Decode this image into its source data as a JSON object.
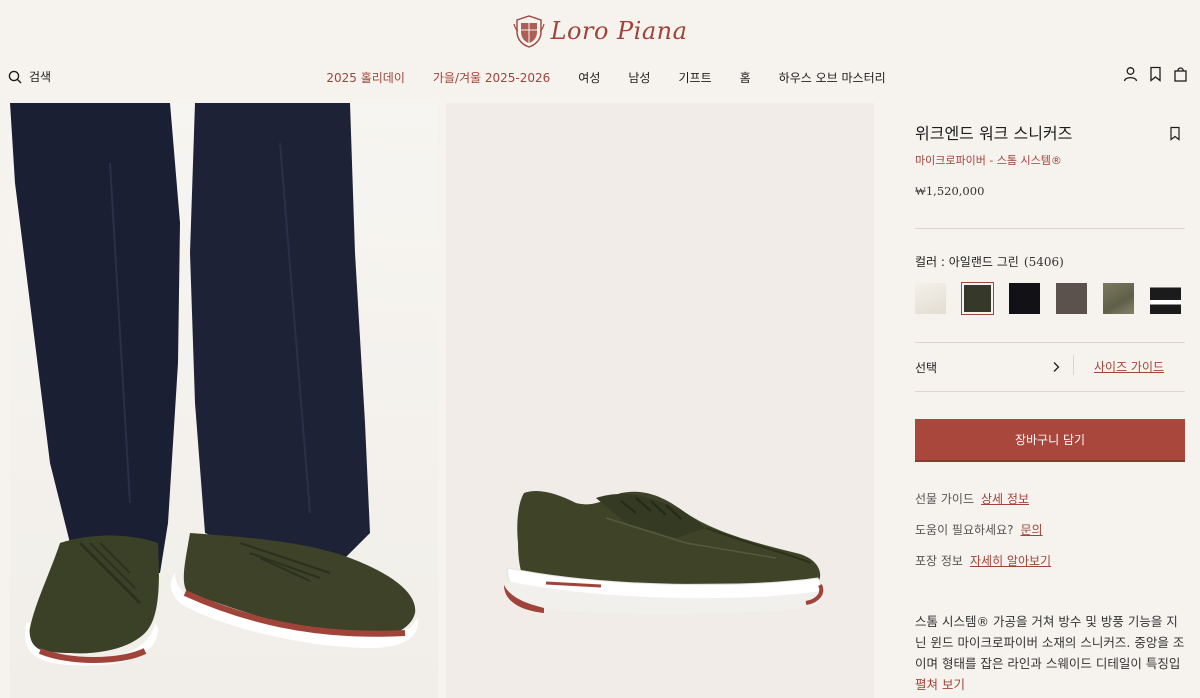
{
  "brand": {
    "name": "Loro Piana"
  },
  "header": {
    "search_label": "검색",
    "nav": [
      {
        "label": "2025 홀리데이",
        "highlight": true
      },
      {
        "label": "가을/겨울 2025-2026",
        "highlight": true
      },
      {
        "label": "여성",
        "highlight": false
      },
      {
        "label": "남성",
        "highlight": false
      },
      {
        "label": "기프트",
        "highlight": false
      },
      {
        "label": "홈",
        "highlight": false
      },
      {
        "label": "하우스 오브 마스터리",
        "highlight": false
      }
    ],
    "icons": [
      "account-icon",
      "bookmark-icon",
      "shopping-bag-icon"
    ]
  },
  "product": {
    "title": "위크엔드 워크 스니커즈",
    "subtitle": "마이크로파이버 - 스톰 시스템®",
    "price": "₩1,520,000",
    "color_label": "컬러 : 아일랜드 그린",
    "color_code": "(5406)",
    "swatches": [
      {
        "name": "ivory",
        "color": "#e6e1d8",
        "selected": false
      },
      {
        "name": "island-green",
        "color": "#3a3d2b",
        "selected": true
      },
      {
        "name": "black",
        "color": "#111114",
        "selected": false
      },
      {
        "name": "brown-grey",
        "color": "#5b524d",
        "selected": false
      },
      {
        "name": "olive",
        "color": "#6f6d55",
        "selected": false
      },
      {
        "name": "black-white",
        "color": "#1b1b1b",
        "selected": false
      }
    ],
    "select_label": "선택",
    "size_guide": "사이즈 가이드",
    "add_to_cart": "장바구니 담기",
    "gift_guide_label": "선물 가이드",
    "gift_guide_link": "상세 정보",
    "help_label": "도움이 필요하세요?",
    "help_link": "문의",
    "packaging_label": "포장 정보",
    "packaging_link": "자세히 알아보기",
    "description": "스톰 시스템® 가공을 거쳐 방수 및 방풍 기능을 지닌 윈드 마이크로파이버 소재의 스니커즈. 중앙을 조이며 형태를 잡은 라인과 스웨이드 디테일이 특징입니다.",
    "more": "펼쳐 보기"
  },
  "colors": {
    "accent": "#a0443a",
    "button": "#a9473d",
    "background": "#f6f3ef"
  }
}
